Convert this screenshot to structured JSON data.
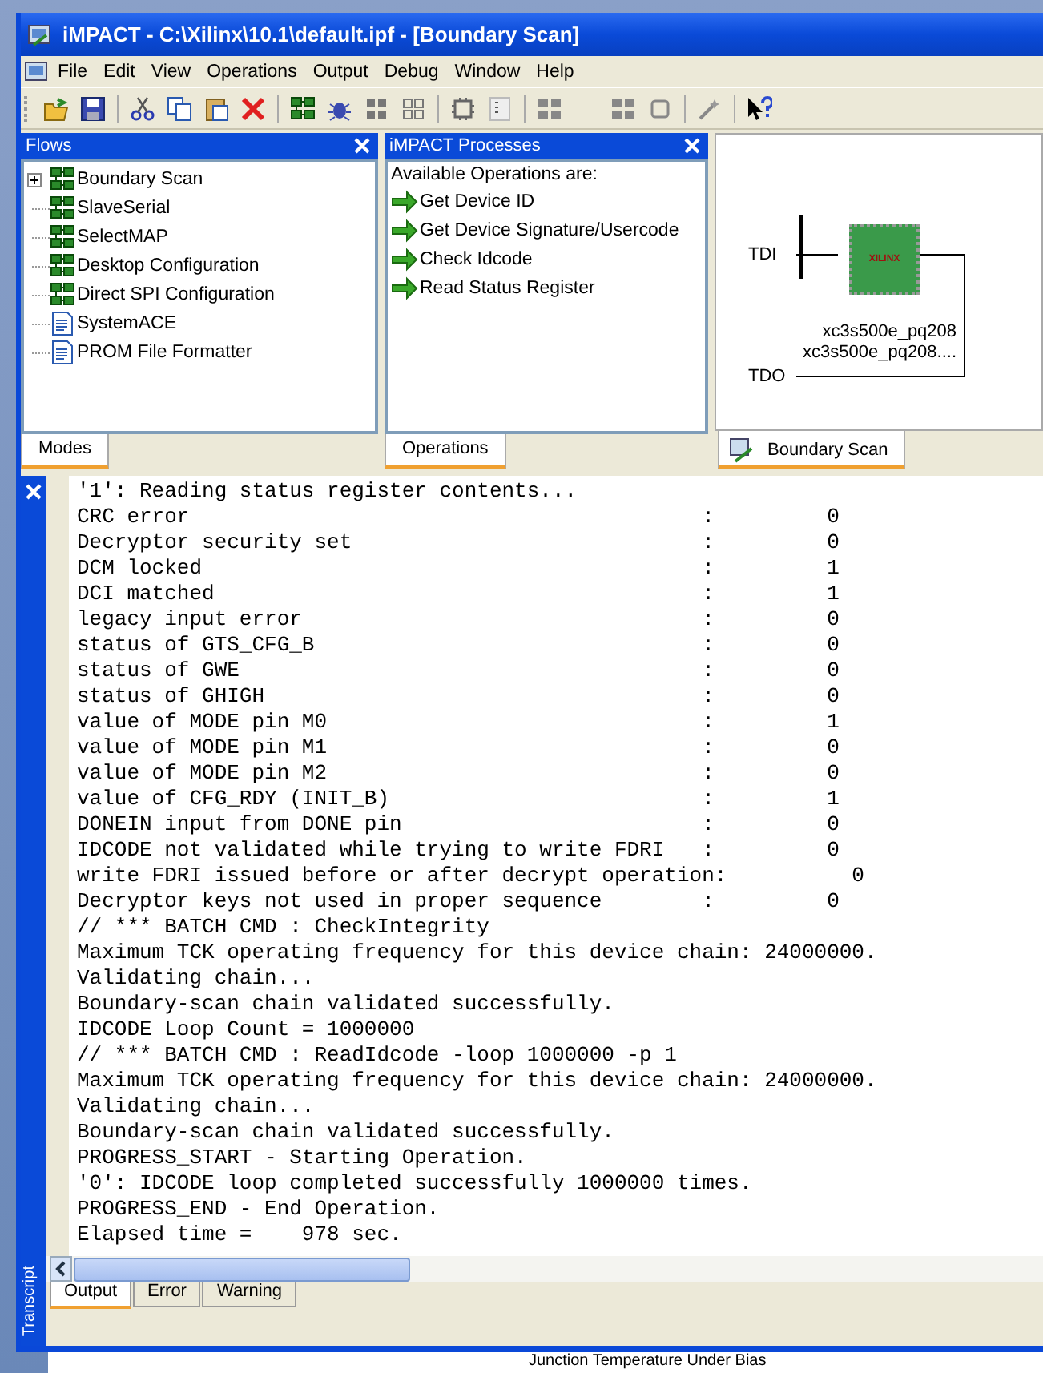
{
  "window": {
    "title": "iMPACT - C:\\Xilinx\\10.1\\default.ipf - [Boundary Scan]"
  },
  "menu": [
    "File",
    "Edit",
    "View",
    "Operations",
    "Output",
    "Debug",
    "Window",
    "Help"
  ],
  "flows": {
    "title": "Flows",
    "tab": "Modes",
    "items": [
      {
        "label": "Boundary Scan",
        "kind": "group"
      },
      {
        "label": "SlaveSerial",
        "kind": "chain"
      },
      {
        "label": "SelectMAP",
        "kind": "chain"
      },
      {
        "label": "Desktop Configuration",
        "kind": "chain"
      },
      {
        "label": "Direct SPI Configuration",
        "kind": "chain"
      },
      {
        "label": "SystemACE",
        "kind": "file"
      },
      {
        "label": "PROM File Formatter",
        "kind": "file"
      }
    ]
  },
  "processes": {
    "title": "iMPACT Processes",
    "tab": "Operations",
    "heading": "Available Operations are:",
    "items": [
      "Get Device ID",
      "Get Device Signature/Usercode",
      "Check Idcode",
      "Read Status Register"
    ]
  },
  "chain": {
    "tab": "Boundary Scan",
    "tdi": "TDI",
    "tdo": "TDO",
    "chip_label": "XILINX",
    "device_lines": [
      "xc3s500e_pq208",
      "xc3s500e_pq208...."
    ]
  },
  "transcript": {
    "label": "Transcript",
    "lines": [
      "'1': Reading status register contents...",
      "CRC error                                         :         0",
      "Decryptor security set                            :         0",
      "DCM locked                                        :         1",
      "DCI matched                                       :         1",
      "legacy input error                                :         0",
      "status of GTS_CFG_B                               :         0",
      "status of GWE                                     :         0",
      "status of GHIGH                                   :         0",
      "value of MODE pin M0                              :         1",
      "value of MODE pin M1                              :         0",
      "value of MODE pin M2                              :         0",
      "value of CFG_RDY (INIT_B)                         :         1",
      "DONEIN input from DONE pin                        :         0",
      "IDCODE not validated while trying to write FDRI   :         0",
      "write FDRI issued before or after decrypt operation:          0",
      "Decryptor keys not used in proper sequence        :         0",
      "// *** BATCH CMD : CheckIntegrity",
      "Maximum TCK operating frequency for this device chain: 24000000.",
      "Validating chain...",
      "Boundary-scan chain validated successfully.",
      "IDCODE Loop Count = 1000000",
      "// *** BATCH CMD : ReadIdcode -loop 1000000 -p 1",
      "Maximum TCK operating frequency for this device chain: 24000000.",
      "Validating chain...",
      "Boundary-scan chain validated successfully.",
      "PROGRESS_START - Starting Operation.",
      "'0': IDCODE loop completed successfully 1000000 times.",
      "PROGRESS_END - End Operation.",
      "Elapsed time =    978 sec."
    ],
    "tabs": [
      {
        "label": "Output",
        "selected": true
      },
      {
        "label": "Error",
        "selected": false
      },
      {
        "label": "Warning",
        "selected": false
      }
    ]
  },
  "background_text": "Junction Temperature Under Bias"
}
